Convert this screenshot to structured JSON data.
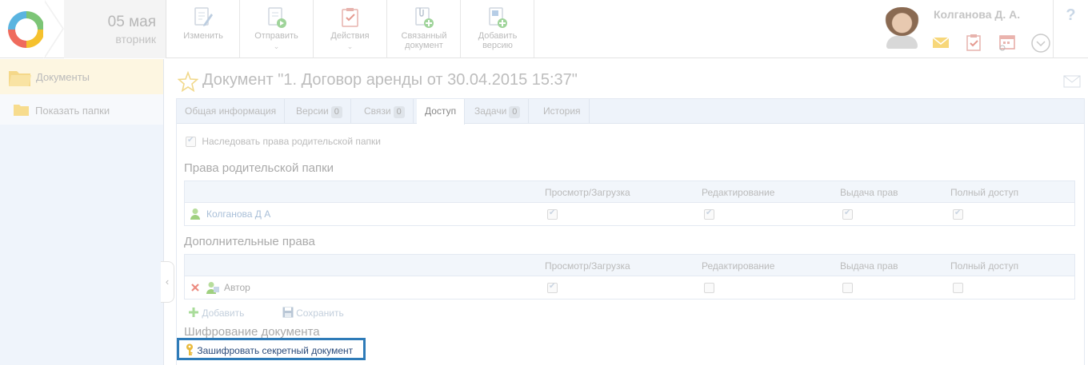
{
  "header": {
    "date_day": "05 мая",
    "date_weekday": "вторник",
    "toolbar": [
      {
        "label": "Изменить",
        "icon": "edit-document-icon",
        "dropdown": false
      },
      {
        "label": "Отправить",
        "icon": "send-document-icon",
        "dropdown": true
      },
      {
        "label": "Действия",
        "icon": "actions-checklist-icon",
        "dropdown": true
      },
      {
        "label": "Связанный документ",
        "icon": "linked-document-icon",
        "dropdown": false
      },
      {
        "label": "Добавить версию",
        "icon": "add-version-icon",
        "dropdown": false
      }
    ],
    "user_name": "Колганова Д. А.",
    "help": "?"
  },
  "sidebar": {
    "items": [
      {
        "label": "Документы",
        "active": true
      },
      {
        "label": "Показать папки",
        "active": false
      }
    ]
  },
  "document": {
    "title": "Документ \"1. Договор аренды от 30.04.2015 15:37\""
  },
  "tabs": [
    {
      "label": "Общая информация",
      "count": ""
    },
    {
      "label": "Версии",
      "count": "0"
    },
    {
      "label": "Связи",
      "count": "0"
    },
    {
      "label": "Доступ",
      "count": "",
      "active": true
    },
    {
      "label": "Задачи",
      "count": "0"
    },
    {
      "label": "История",
      "count": ""
    }
  ],
  "access": {
    "inherit_label": "Наследовать права родительской папки",
    "inherit_checked": true,
    "parent_title": "Права родительской папки",
    "columns": [
      "Просмотр/Загрузка",
      "Редактирование",
      "Выдача прав",
      "Полный доступ"
    ],
    "parent_rows": [
      {
        "name": "Колганова Д А",
        "perms": [
          true,
          true,
          true,
          true
        ]
      }
    ],
    "extra_title": "Дополнительные права",
    "extra_rows": [
      {
        "name": "Автор",
        "perms": [
          true,
          false,
          false,
          false
        ]
      }
    ],
    "add_label": "Добавить",
    "save_label": "Сохранить"
  },
  "encryption": {
    "title": "Шифрование документа",
    "button_label": "Зашифровать секретный документ"
  },
  "colors": {
    "accent_border": "#2e7bb8",
    "sidebar_active_bg": "#fdf6e1",
    "tabs_bg": "#eef3fa"
  }
}
